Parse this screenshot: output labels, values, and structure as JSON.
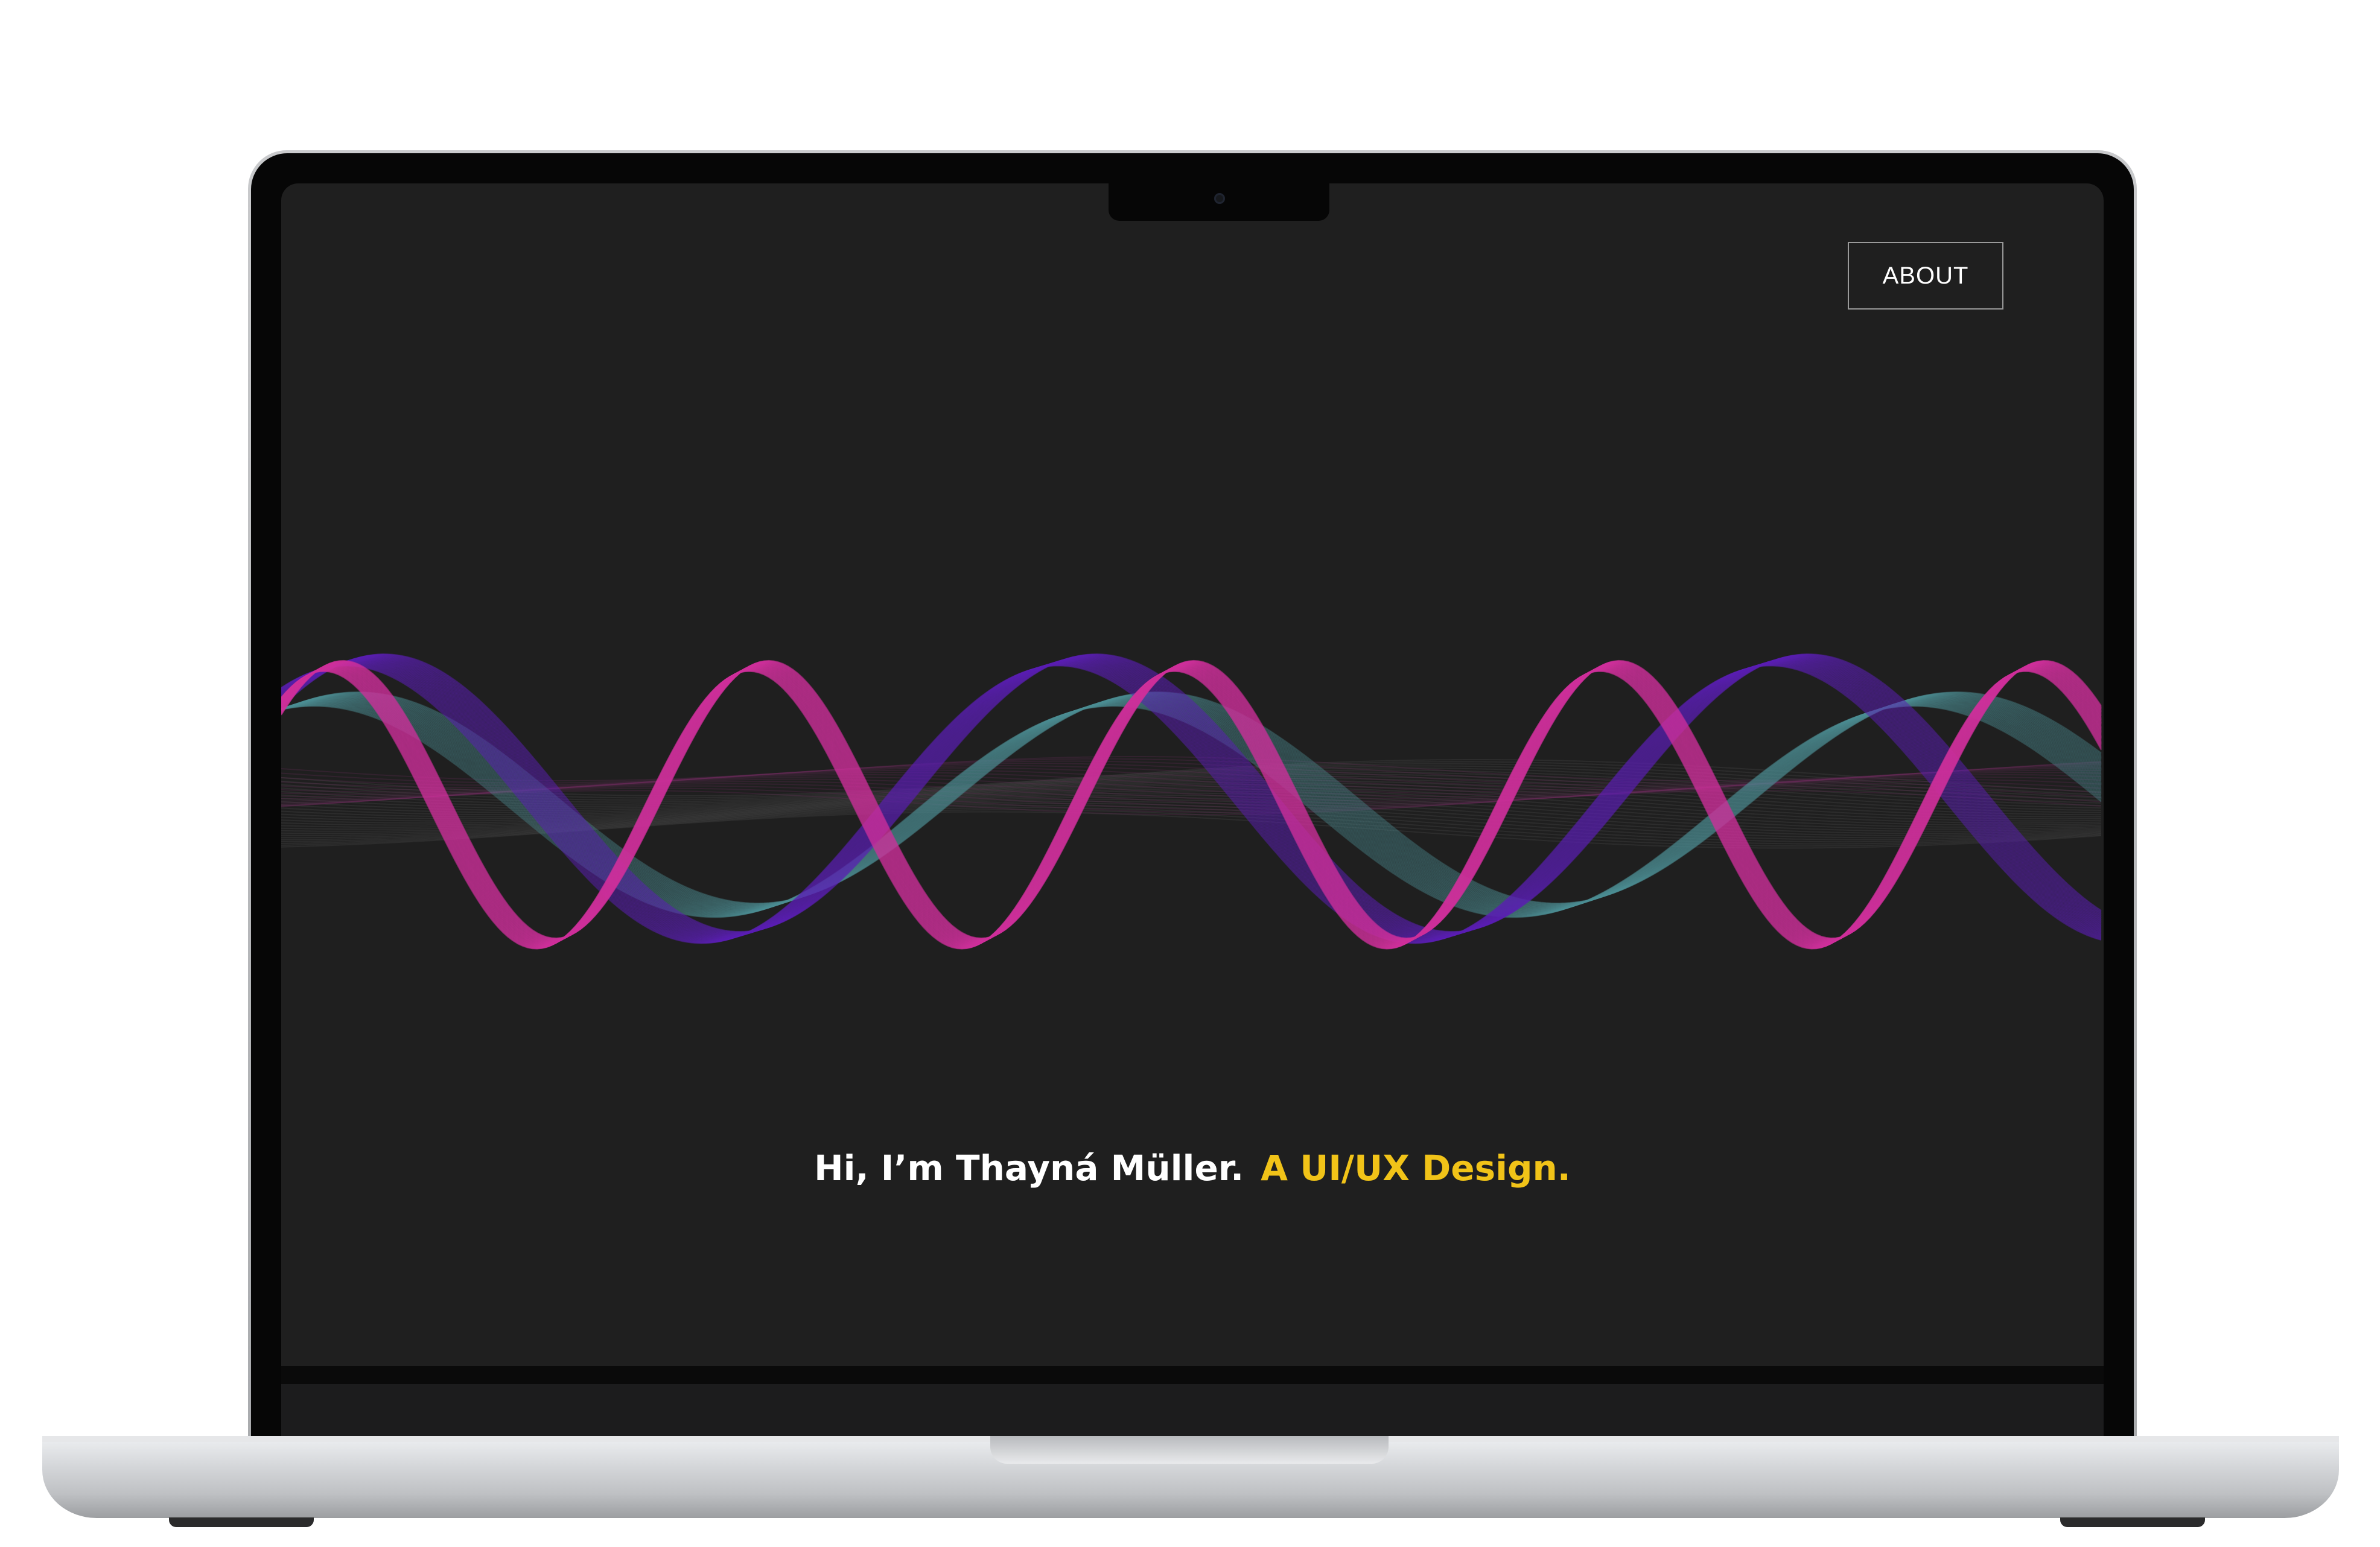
{
  "nav": {
    "about_label": "ABOUT"
  },
  "hero": {
    "intro": "Hi, I’m Thayná Müller.",
    "role": "A UI/UX Design."
  },
  "colors": {
    "background": "#1f1f1f",
    "accent": "#f1c318",
    "wave_magenta": "#d0309c",
    "wave_purple": "#5b1fb3",
    "wave_teal": "#4d8f96"
  },
  "devices": {
    "frame": "laptop-mockup"
  }
}
